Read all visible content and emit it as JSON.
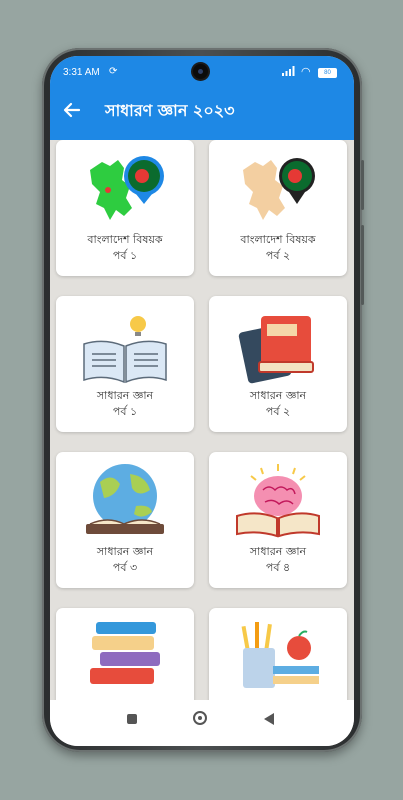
{
  "status_bar": {
    "time": "3:31 AM",
    "battery": "80"
  },
  "app_bar": {
    "title": "সাধারণ জ্ঞান ২০২৩",
    "back_icon": "arrow-left-icon",
    "color": "#1e88e5"
  },
  "cards": [
    {
      "line1": "বাংলাদেশ বিষয়ক",
      "line2": "পর্ব ১",
      "icon": "bangladesh-map-icon"
    },
    {
      "line1": "বাংলাদেশ বিষয়ক",
      "line2": "পর্ব ২",
      "icon": "bangladesh-map-icon"
    },
    {
      "line1": "সাধারন জ্ঞান",
      "line2": "পর্ব ১",
      "icon": "open-book-bulb-icon"
    },
    {
      "line1": "সাধারন জ্ঞান",
      "line2": "পর্ব ২",
      "icon": "books-stack-icon"
    },
    {
      "line1": "সাধারন জ্ঞান",
      "line2": "পর্ব ৩",
      "icon": "globe-book-icon"
    },
    {
      "line1": "সাধারন জ্ঞান",
      "line2": "পর্ব ৪",
      "icon": "brain-book-icon"
    },
    {
      "line1": "",
      "line2": "",
      "icon": "books-pile-icon"
    },
    {
      "line1": "",
      "line2": "",
      "icon": "stationery-apple-icon"
    }
  ]
}
